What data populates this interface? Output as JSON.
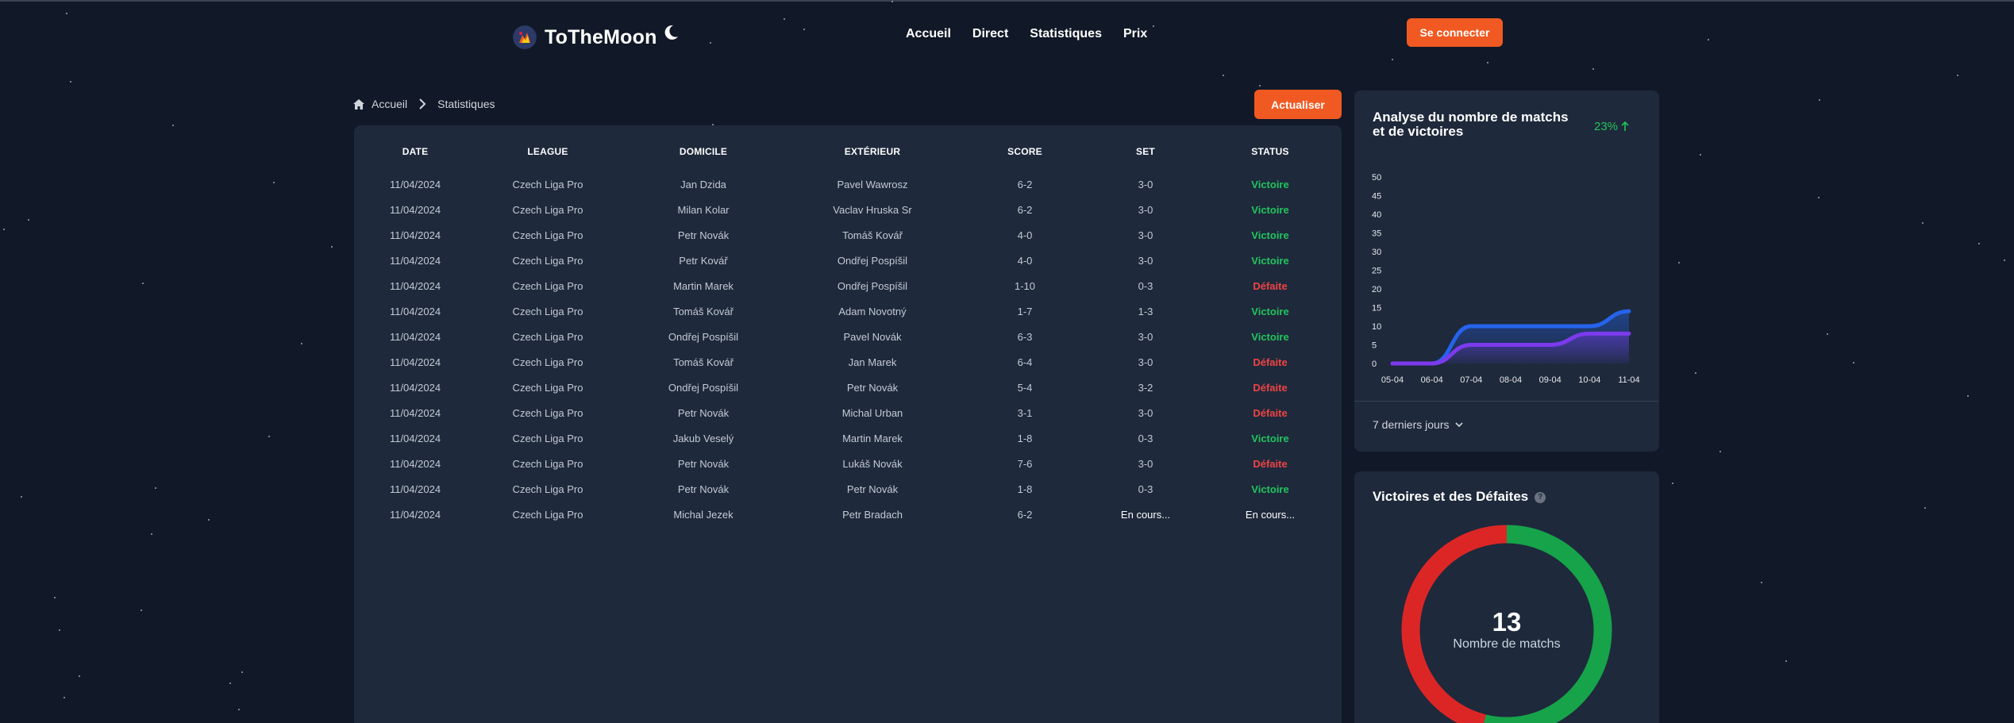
{
  "header": {
    "brand": "ToTheMoon",
    "nav": [
      "Accueil",
      "Direct",
      "Statistiques",
      "Prix"
    ],
    "login_label": "Se connecter"
  },
  "breadcrumb": {
    "home": "Accueil",
    "current": "Statistiques"
  },
  "refresh_label": "Actualiser",
  "table": {
    "headers": [
      "DATE",
      "LEAGUE",
      "DOMICILE",
      "EXTÉRIEUR",
      "SCORE",
      "SET",
      "STATUS"
    ],
    "rows": [
      [
        "11/04/2024",
        "Czech Liga Pro",
        "Jan Dzida",
        "Pavel Wawrosz",
        "6-2",
        "3-0",
        "Victoire"
      ],
      [
        "11/04/2024",
        "Czech Liga Pro",
        "Milan Kolar",
        "Vaclav Hruska Sr",
        "6-2",
        "3-0",
        "Victoire"
      ],
      [
        "11/04/2024",
        "Czech Liga Pro",
        "Petr Novák",
        "Tomáš Kovář",
        "4-0",
        "3-0",
        "Victoire"
      ],
      [
        "11/04/2024",
        "Czech Liga Pro",
        "Petr Kovář",
        "Ondřej Pospíšil",
        "4-0",
        "3-0",
        "Victoire"
      ],
      [
        "11/04/2024",
        "Czech Liga Pro",
        "Martin Marek",
        "Ondřej Pospíšil",
        "1-10",
        "0-3",
        "Défaite"
      ],
      [
        "11/04/2024",
        "Czech Liga Pro",
        "Tomáš Kovář",
        "Adam Novotný",
        "1-7",
        "1-3",
        "Victoire"
      ],
      [
        "11/04/2024",
        "Czech Liga Pro",
        "Ondřej Pospíšil",
        "Pavel Novák",
        "6-3",
        "3-0",
        "Victoire"
      ],
      [
        "11/04/2024",
        "Czech Liga Pro",
        "Tomáš Kovář",
        "Jan Marek",
        "6-4",
        "3-0",
        "Défaite"
      ],
      [
        "11/04/2024",
        "Czech Liga Pro",
        "Ondřej Pospíšil",
        "Petr Novák",
        "5-4",
        "3-2",
        "Défaite"
      ],
      [
        "11/04/2024",
        "Czech Liga Pro",
        "Petr Novák",
        "Michal Urban",
        "3-1",
        "3-0",
        "Défaite"
      ],
      [
        "11/04/2024",
        "Czech Liga Pro",
        "Jakub Veselý",
        "Martin Marek",
        "1-8",
        "0-3",
        "Victoire"
      ],
      [
        "11/04/2024",
        "Czech Liga Pro",
        "Petr Novák",
        "Lukáš Novák",
        "7-6",
        "3-0",
        "Défaite"
      ],
      [
        "11/04/2024",
        "Czech Liga Pro",
        "Petr Novák",
        "Petr Novák",
        "1-8",
        "0-3",
        "Victoire"
      ],
      [
        "11/04/2024",
        "Czech Liga Pro",
        "Michal Jezek",
        "Petr Bradach",
        "6-2",
        "En cours...",
        "En cours..."
      ]
    ]
  },
  "analysis_card": {
    "title_line1": "Analyse du nombre de matchs",
    "title_line2": "et de victoires",
    "trend": "23%",
    "range_label": "7 derniers jours"
  },
  "donut_card": {
    "title": "Victoires et des Défaites",
    "count": "13",
    "count_label": "Nombre de matchs"
  },
  "colors": {
    "background": "#111827",
    "panel": "#1e293b",
    "accent": "#f05a22",
    "win": "#22c55e",
    "loss": "#ef4444",
    "series_blue": "#2563eb",
    "series_purple": "#7c3aed",
    "donut_green": "#16a34a",
    "donut_red": "#dc2626"
  },
  "chart_data": [
    {
      "type": "area",
      "categories": [
        "05-04",
        "06-04",
        "07-04",
        "08-04",
        "09-04",
        "10-04",
        "11-04"
      ],
      "ylim": [
        0,
        50
      ],
      "yticks": [
        0,
        5,
        10,
        15,
        20,
        25,
        30,
        35,
        40,
        45,
        50
      ],
      "series": [
        {
          "color": "#2563eb",
          "values": [
            0,
            0,
            10,
            10,
            10,
            10,
            14
          ]
        },
        {
          "color": "#7c3aed",
          "values": [
            0,
            0,
            5,
            5,
            5,
            8,
            8
          ]
        }
      ],
      "grid": false
    },
    {
      "type": "pie",
      "donut": true,
      "slices": [
        {
          "value": 7,
          "color": "#16a34a"
        },
        {
          "value": 6,
          "color": "#dc2626"
        }
      ]
    }
  ]
}
